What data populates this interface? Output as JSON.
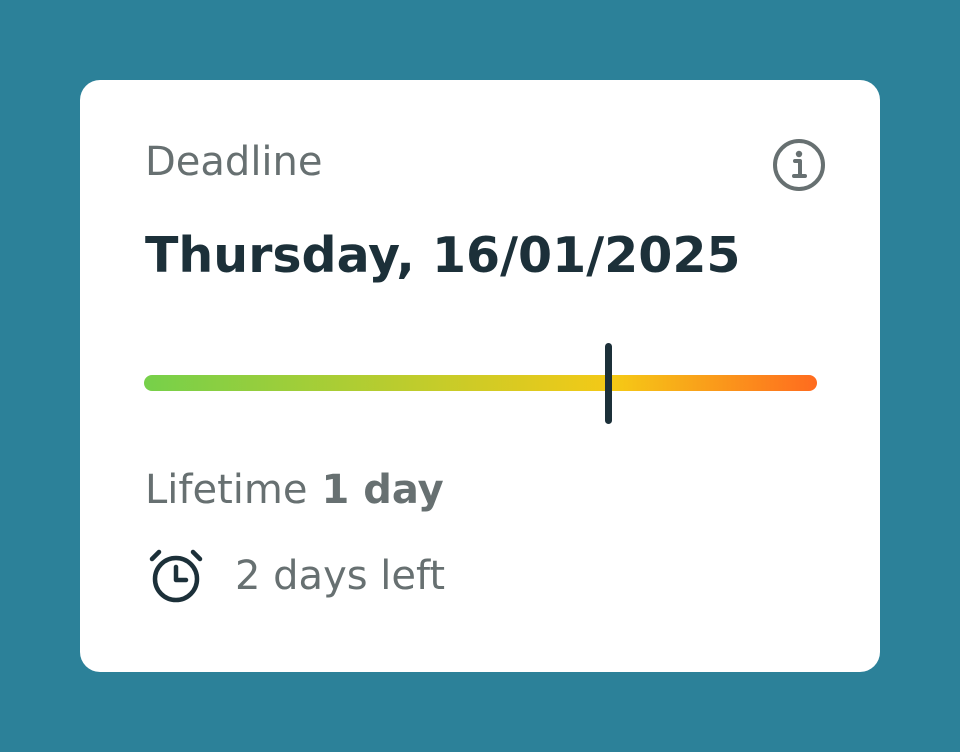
{
  "card": {
    "title": "Deadline",
    "date": "Thursday, 16/01/2025",
    "progress": 0.69,
    "lifetime_label": "Lifetime",
    "lifetime_value": "1 day",
    "remaining": "2 days left"
  },
  "icons": {
    "info": "info-circle-icon",
    "alarm": "alarm-clock-icon"
  },
  "colors": {
    "background": "#2c8199",
    "card": "#ffffff",
    "text_primary": "#1c3039",
    "text_secondary": "#677071",
    "marker": "#1c3039",
    "gradient_start": "#76d04a",
    "gradient_mid": "#f5c916",
    "gradient_end": "#ff6b1f"
  }
}
